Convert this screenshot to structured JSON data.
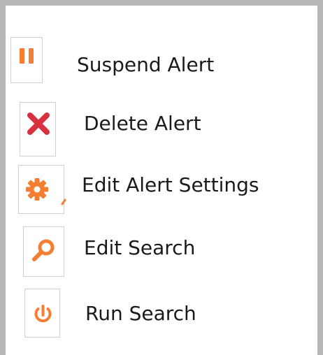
{
  "menu": {
    "items": [
      {
        "label": "Suspend Alert",
        "icon": "pause-icon",
        "icon_color": "#f47f33"
      },
      {
        "label": "Delete Alert",
        "icon": "close-icon",
        "icon_color": "#d9303f"
      },
      {
        "label": "Edit Alert Settings",
        "icon": "gear-icon",
        "icon_color": "#f47f33"
      },
      {
        "label": "Edit Search",
        "icon": "search-icon",
        "icon_color": "#f47f33"
      },
      {
        "label": "Run Search",
        "icon": "power-icon",
        "icon_color": "#f47f33"
      }
    ]
  }
}
